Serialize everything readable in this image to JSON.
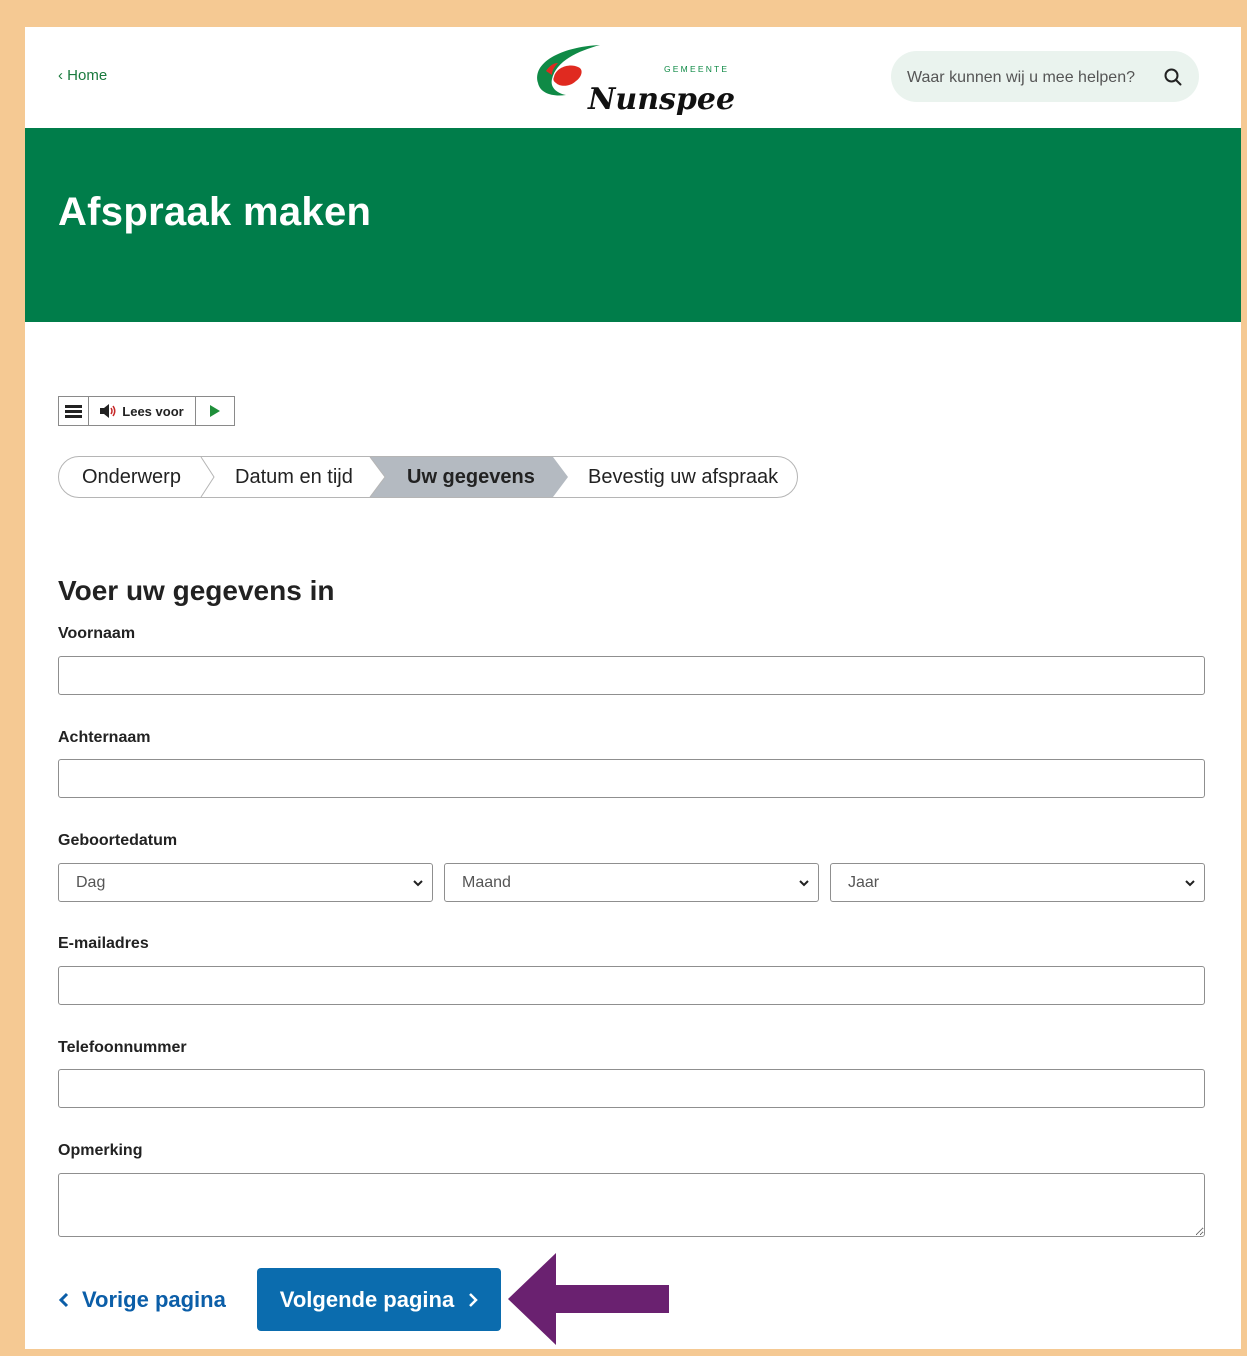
{
  "header": {
    "home_link": "Home",
    "logo_wordmark": "Nunspeet",
    "logo_small": "GEMEENTE",
    "search_placeholder": "Waar kunnen wij u mee helpen?"
  },
  "hero": {
    "title": "Afspraak maken"
  },
  "reader": {
    "label": "Lees voor"
  },
  "stepper": {
    "steps": [
      "Onderwerp",
      "Datum en tijd",
      "Uw gegevens",
      "Bevestig uw afspraak"
    ],
    "active_index": 2
  },
  "form": {
    "title": "Voer uw gegevens in",
    "firstname_label": "Voornaam",
    "lastname_label": "Achternaam",
    "birthdate_label": "Geboortedatum",
    "day_value": "Dag",
    "month_value": "Maand",
    "year_value": "Jaar",
    "email_label": "E-mailadres",
    "phone_label": "Telefoonnummer",
    "remark_label": "Opmerking"
  },
  "nav": {
    "prev_label": "Vorige pagina",
    "next_label": "Volgende pagina"
  },
  "colors": {
    "brand_green": "#007d4a",
    "button_blue": "#0b6cae",
    "link_blue": "#0b5ea8",
    "annotation_arrow": "#6a2170",
    "frame": "#f5c993"
  }
}
